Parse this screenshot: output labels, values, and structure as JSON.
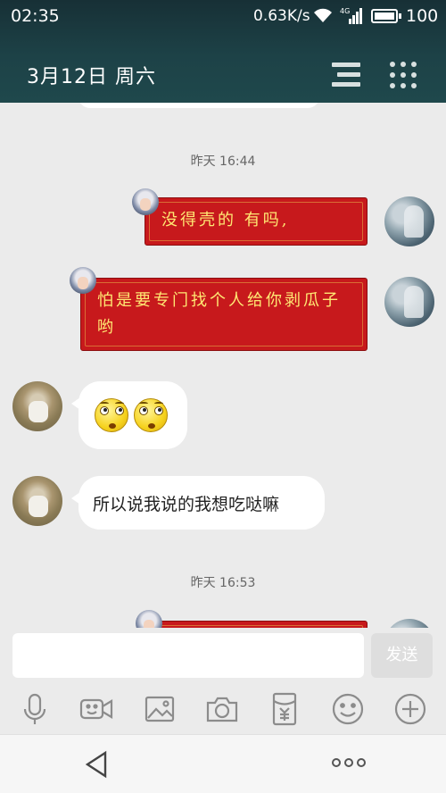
{
  "status_bar": {
    "time": "02:35",
    "network_speed": "0.63K/s",
    "network_type": "4G",
    "battery": "100",
    "icons": [
      "wifi-icon",
      "signal-icon",
      "battery-icon"
    ]
  },
  "header": {
    "title": "3月12日 周六",
    "icons": [
      "menu-icon",
      "grid-icon"
    ]
  },
  "messages": [
    {
      "type": "timestamp",
      "text": "昨天 16:44"
    },
    {
      "type": "outgoing",
      "style": "red-card",
      "text": "没得壳的        有吗,",
      "avatar": "avatar-me"
    },
    {
      "type": "outgoing",
      "style": "red-card",
      "text": "怕是要专门找个人给你剥瓜子哟",
      "avatar": "avatar-me"
    },
    {
      "type": "incoming",
      "style": "emoji",
      "emojis": [
        "rolling-eyes-emoji",
        "rolling-eyes-emoji"
      ],
      "avatar": "avatar-her"
    },
    {
      "type": "incoming",
      "style": "text",
      "text": "所以说我说的我想吃哒嘛",
      "avatar": "avatar-her"
    },
    {
      "type": "timestamp",
      "text": "昨天 16:53"
    }
  ],
  "input": {
    "value": "",
    "send_label": "发送"
  },
  "toolbar_icons": [
    "microphone-icon",
    "video-icon",
    "image-icon",
    "camera-icon",
    "red-packet-icon",
    "emoji-icon",
    "add-icon"
  ],
  "nav": {
    "icons": [
      "back-icon",
      "more-icon"
    ]
  },
  "colors": {
    "header_bg": "#1d4247",
    "red_card": "#c7191c",
    "red_card_text": "#ffe873",
    "chat_bg": "#ebebeb"
  }
}
